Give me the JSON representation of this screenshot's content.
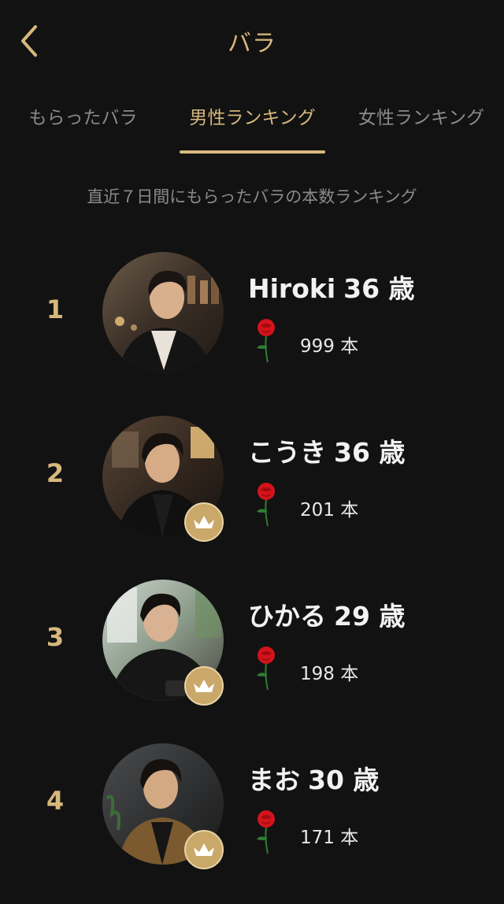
{
  "header": {
    "title": "バラ"
  },
  "tabs": [
    {
      "label": "もらったバラ",
      "active": false
    },
    {
      "label": "男性ランキング",
      "active": true
    },
    {
      "label": "女性ランキング",
      "active": false
    }
  ],
  "subtitle": "直近７日間にもらったバラの本数ランキング",
  "colors": {
    "background": "#121212",
    "accent_gold": "#d7b87c",
    "rose_red": "#d4131b",
    "inactive_text": "#8a8a8a"
  },
  "ranking": [
    {
      "rank": "1",
      "name": "Hiroki",
      "age": "36 歳",
      "count": "999 本",
      "has_crown_badge": false,
      "icon": "rose-icon"
    },
    {
      "rank": "2",
      "name": "こうき",
      "age": "36 歳",
      "count": "201 本",
      "has_crown_badge": true,
      "icon": "rose-icon"
    },
    {
      "rank": "3",
      "name": "ひかる",
      "age": "29 歳",
      "count": "198 本",
      "has_crown_badge": true,
      "icon": "rose-icon"
    },
    {
      "rank": "4",
      "name": "まお",
      "age": "30 歳",
      "count": "171 本",
      "has_crown_badge": true,
      "icon": "rose-icon"
    }
  ]
}
